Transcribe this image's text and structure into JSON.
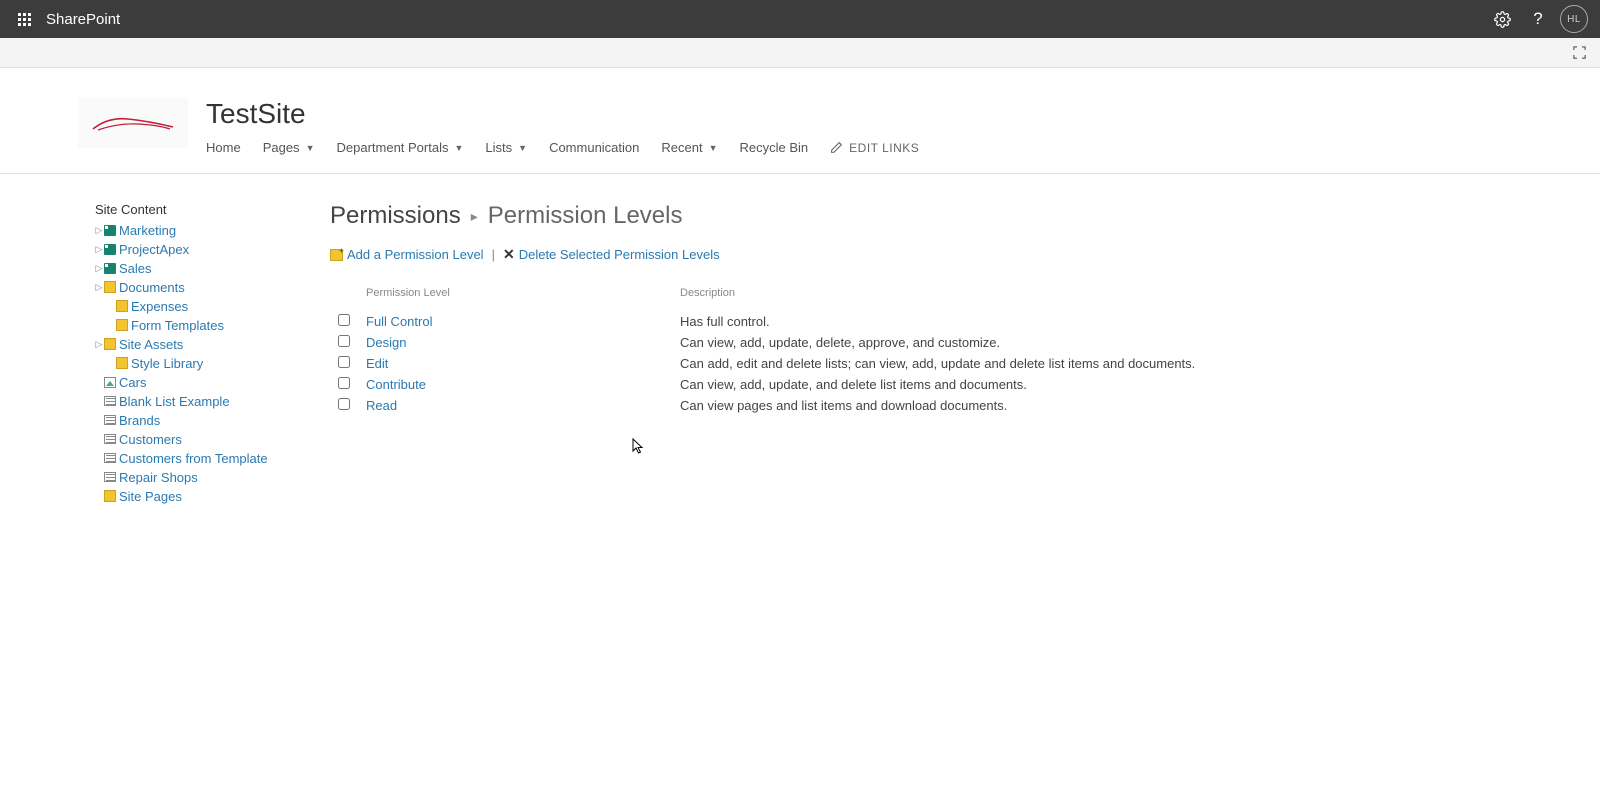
{
  "suite": {
    "app_name": "SharePoint",
    "user_initials": "HL"
  },
  "site": {
    "title": "TestSite",
    "nav": {
      "home": "Home",
      "pages": "Pages",
      "dept": "Department Portals",
      "lists": "Lists",
      "comm": "Communication",
      "recent": "Recent",
      "recycle": "Recycle Bin",
      "edit_links": "EDIT LINKS"
    }
  },
  "sidebar": {
    "heading": "Site Content",
    "items": [
      {
        "label": "Marketing",
        "icon": "site",
        "expandable": true,
        "indent": 1
      },
      {
        "label": "ProjectApex",
        "icon": "site",
        "expandable": true,
        "indent": 1
      },
      {
        "label": "Sales",
        "icon": "site",
        "expandable": true,
        "indent": 1
      },
      {
        "label": "Documents",
        "icon": "lib",
        "expandable": true,
        "indent": 1
      },
      {
        "label": "Expenses",
        "icon": "lib",
        "expandable": false,
        "indent": 2
      },
      {
        "label": "Form Templates",
        "icon": "lib",
        "expandable": false,
        "indent": 2
      },
      {
        "label": "Site Assets",
        "icon": "lib",
        "expandable": true,
        "indent": 1
      },
      {
        "label": "Style Library",
        "icon": "lib",
        "expandable": false,
        "indent": 2
      },
      {
        "label": "Cars",
        "icon": "piclib",
        "expandable": false,
        "indent": 1
      },
      {
        "label": "Blank List Example",
        "icon": "list",
        "expandable": false,
        "indent": 1
      },
      {
        "label": "Brands",
        "icon": "list",
        "expandable": false,
        "indent": 1
      },
      {
        "label": "Customers",
        "icon": "list",
        "expandable": false,
        "indent": 1
      },
      {
        "label": "Customers from Template",
        "icon": "list",
        "expandable": false,
        "indent": 1
      },
      {
        "label": "Repair Shops",
        "icon": "list",
        "expandable": false,
        "indent": 1
      },
      {
        "label": "Site Pages",
        "icon": "lib",
        "expandable": false,
        "indent": 1
      }
    ]
  },
  "breadcrumb": {
    "parent": "Permissions",
    "current": "Permission Levels"
  },
  "toolbar": {
    "add_label": "Add a Permission Level",
    "delete_label": "Delete Selected Permission Levels"
  },
  "table": {
    "col_level": "Permission Level",
    "col_desc": "Description",
    "rows": [
      {
        "name": "Full Control",
        "desc": "Has full control."
      },
      {
        "name": "Design",
        "desc": "Can view, add, update, delete, approve, and customize."
      },
      {
        "name": "Edit",
        "desc": "Can add, edit and delete lists; can view, add, update and delete list items and documents."
      },
      {
        "name": "Contribute",
        "desc": "Can view, add, update, and delete list items and documents."
      },
      {
        "name": "Read",
        "desc": "Can view pages and list items and download documents."
      }
    ]
  }
}
